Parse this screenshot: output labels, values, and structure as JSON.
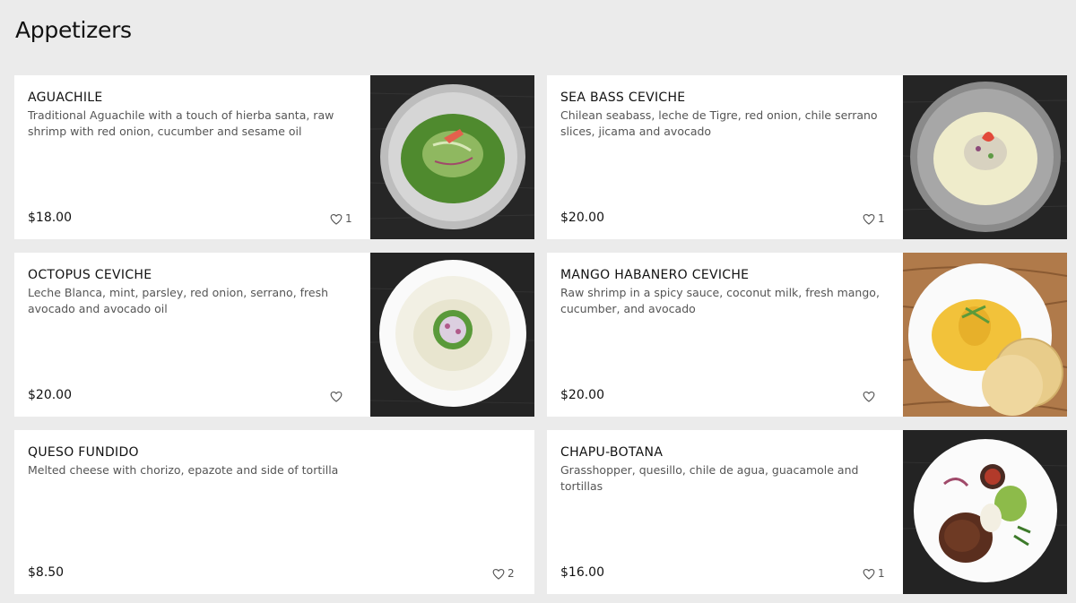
{
  "section": {
    "title": "Appetizers"
  },
  "items": [
    {
      "name": "AGUACHILE",
      "description": "Traditional Aguachile with a touch of hierba santa, raw shrimp with red onion, cucumber and sesame oil",
      "price": "$18.00",
      "likes": "1",
      "image": "green-aguachile-bowl"
    },
    {
      "name": "SEA BASS CEVICHE",
      "description": "Chilean seabass, leche de Tigre, red onion, chile serrano slices, jicama and avocado",
      "price": "$20.00",
      "likes": "1",
      "image": "white-ceviche-bowl"
    },
    {
      "name": "OCTOPUS CEVICHE",
      "description": "Leche Blanca, mint, parsley, red onion, serrano, fresh avocado and avocado oil",
      "price": "$20.00",
      "likes": "",
      "image": "octopus-ceviche-plate"
    },
    {
      "name": "MANGO HABANERO CEVICHE",
      "description": "Raw shrimp in a spicy sauce, coconut milk, fresh mango, cucumber, and avocado",
      "price": "$20.00",
      "likes": "",
      "image": "mango-ceviche-with-tostadas"
    },
    {
      "name": "QUESO FUNDIDO",
      "description": "Melted cheese with chorizo, epazote and side of tortilla",
      "price": "$8.50",
      "likes": "2",
      "image": ""
    },
    {
      "name": "CHAPU-BOTANA",
      "description": "Grasshopper, quesillo, chile de agua, guacamole and tortillas",
      "price": "$16.00",
      "likes": "1",
      "image": "chapulines-plate"
    }
  ]
}
